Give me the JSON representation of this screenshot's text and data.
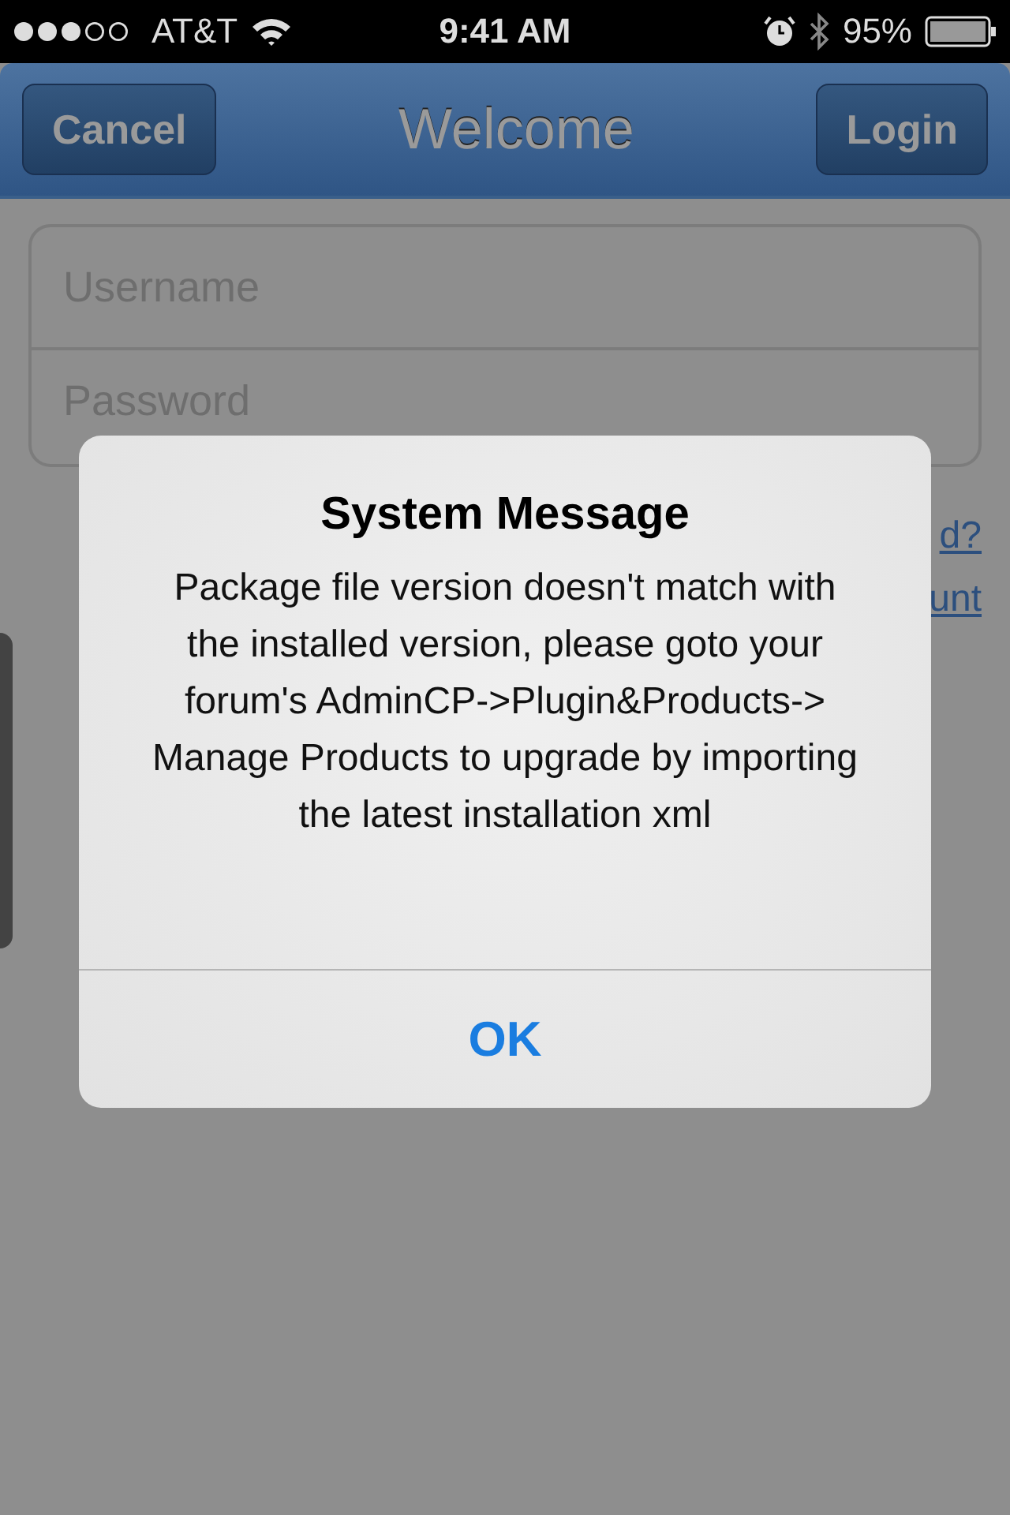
{
  "status_bar": {
    "carrier": "AT&T",
    "time": "9:41 AM",
    "battery": "95%"
  },
  "nav_bar": {
    "left_button": "Cancel",
    "title": "Welcome",
    "right_button": "Login"
  },
  "form": {
    "fields": [
      {
        "placeholder": "Username"
      },
      {
        "placeholder": "Password"
      }
    ],
    "links": [
      "d?",
      "unt"
    ]
  },
  "alert": {
    "title": "System Message",
    "message": "Package file version doesn't match with the installed version, please goto your forum's AdminCP->Plugin&Products-> Manage Products to upgrade by importing the latest installation xml",
    "button": "OK"
  }
}
